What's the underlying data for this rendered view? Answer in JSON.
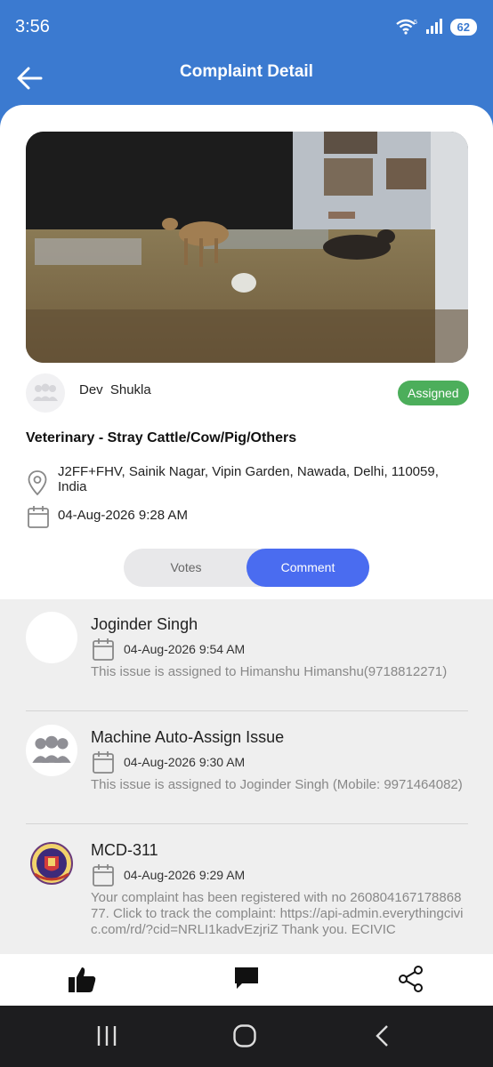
{
  "status_bar": {
    "time": "3:56",
    "battery": "62"
  },
  "header": {
    "title": "Complaint Detail"
  },
  "complaint": {
    "reporter": "Dev Shukla",
    "status": "Assigned",
    "category": "Veterinary - Stray Cattle/Cow/Pig/Others",
    "address": "J2FF+FHV, Sainik Nagar, Vipin Garden, Nawada, Delhi, 110059, India",
    "datetime": "04-Aug-2026 9:28 AM"
  },
  "tabs": {
    "votes": "Votes",
    "comment": "Comment",
    "active": "comment"
  },
  "comments": [
    {
      "author": "Joginder Singh",
      "time": "04-Aug-2026 9:54 AM",
      "text": "This issue is assigned to Himanshu Himanshu(9718812271)"
    },
    {
      "author": "Machine Auto-Assign Issue",
      "time": "04-Aug-2026 9:30 AM",
      "text": "This issue is assigned to Joginder Singh (Mobile: 9971464082)"
    },
    {
      "author": "MCD-311",
      "time": "04-Aug-2026 9:29 AM",
      "text": "Your complaint has been registered with no 26080416717886877. Click to track the complaint: https://api-admin.everythingcivic.com/rd/?cid=NRLI1kadvEzjriZ Thank you. ECIVIC"
    }
  ],
  "colors": {
    "primary": "#3b7ad0",
    "accent": "#4a6cf0",
    "assigned": "#4cae5b"
  },
  "icons": [
    "back-arrow-icon",
    "wifi-icon",
    "signal-icon",
    "location-pin-icon",
    "calendar-icon",
    "thumbs-up-icon",
    "comment-icon",
    "share-icon",
    "recents-icon",
    "home-icon",
    "back-icon"
  ]
}
